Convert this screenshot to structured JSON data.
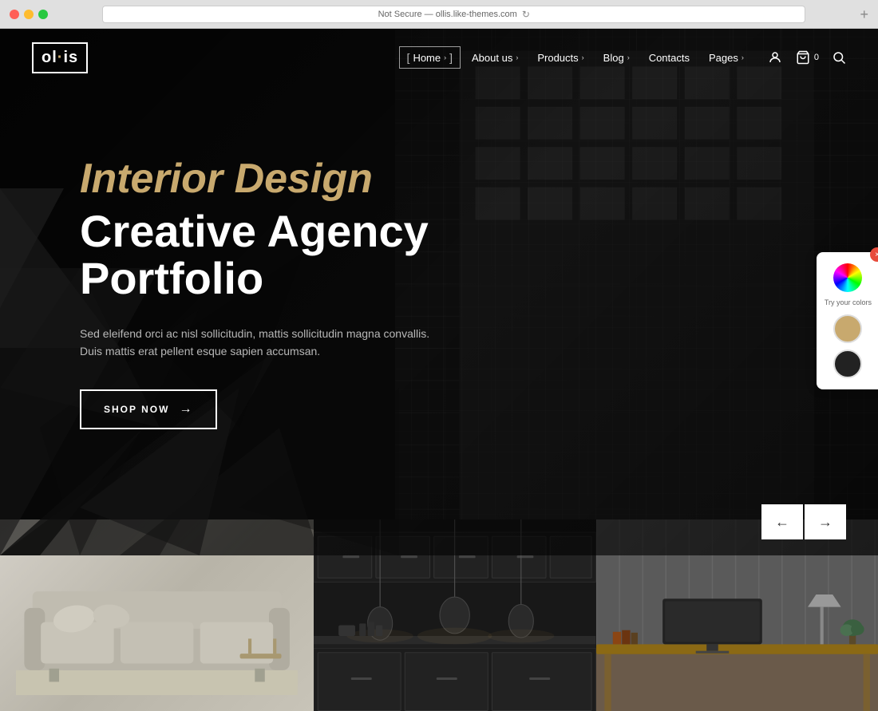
{
  "browser": {
    "url": "Not Secure — ollis.like-themes.com",
    "refresh_icon": "↻"
  },
  "header": {
    "logo": {
      "text_start": "ol",
      "text_dot": "·",
      "text_end": "is",
      "full": "ollis"
    },
    "nav": [
      {
        "label": "Home",
        "active": true,
        "has_chevron": true
      },
      {
        "label": "About us",
        "active": false,
        "has_chevron": true
      },
      {
        "label": "Products",
        "active": false,
        "has_chevron": true
      },
      {
        "label": "Blog",
        "active": false,
        "has_chevron": true
      },
      {
        "label": "Contacts",
        "active": false,
        "has_chevron": false
      },
      {
        "label": "Pages",
        "active": false,
        "has_chevron": true
      }
    ],
    "cart_count": "0",
    "icons": {
      "user": "👤",
      "cart": "🛒",
      "search": "🔍"
    }
  },
  "hero": {
    "title_line1": "Interior Design",
    "title_line2": "Creative Agency Portfolio",
    "description": "Sed eleifend orci ac nisl sollicitudin, mattis sollicitudin magna convallis. Duis mattis erat pellent esque sapien accumsan.",
    "cta_label": "SHOP NOW",
    "cta_arrow": "→"
  },
  "color_panel": {
    "close": "×",
    "label": "Try your colors",
    "swatches": [
      {
        "color": "#c8a96e",
        "name": "gold"
      },
      {
        "color": "#222222",
        "name": "dark"
      }
    ]
  },
  "slide_nav": {
    "prev": "←",
    "next": "→"
  }
}
